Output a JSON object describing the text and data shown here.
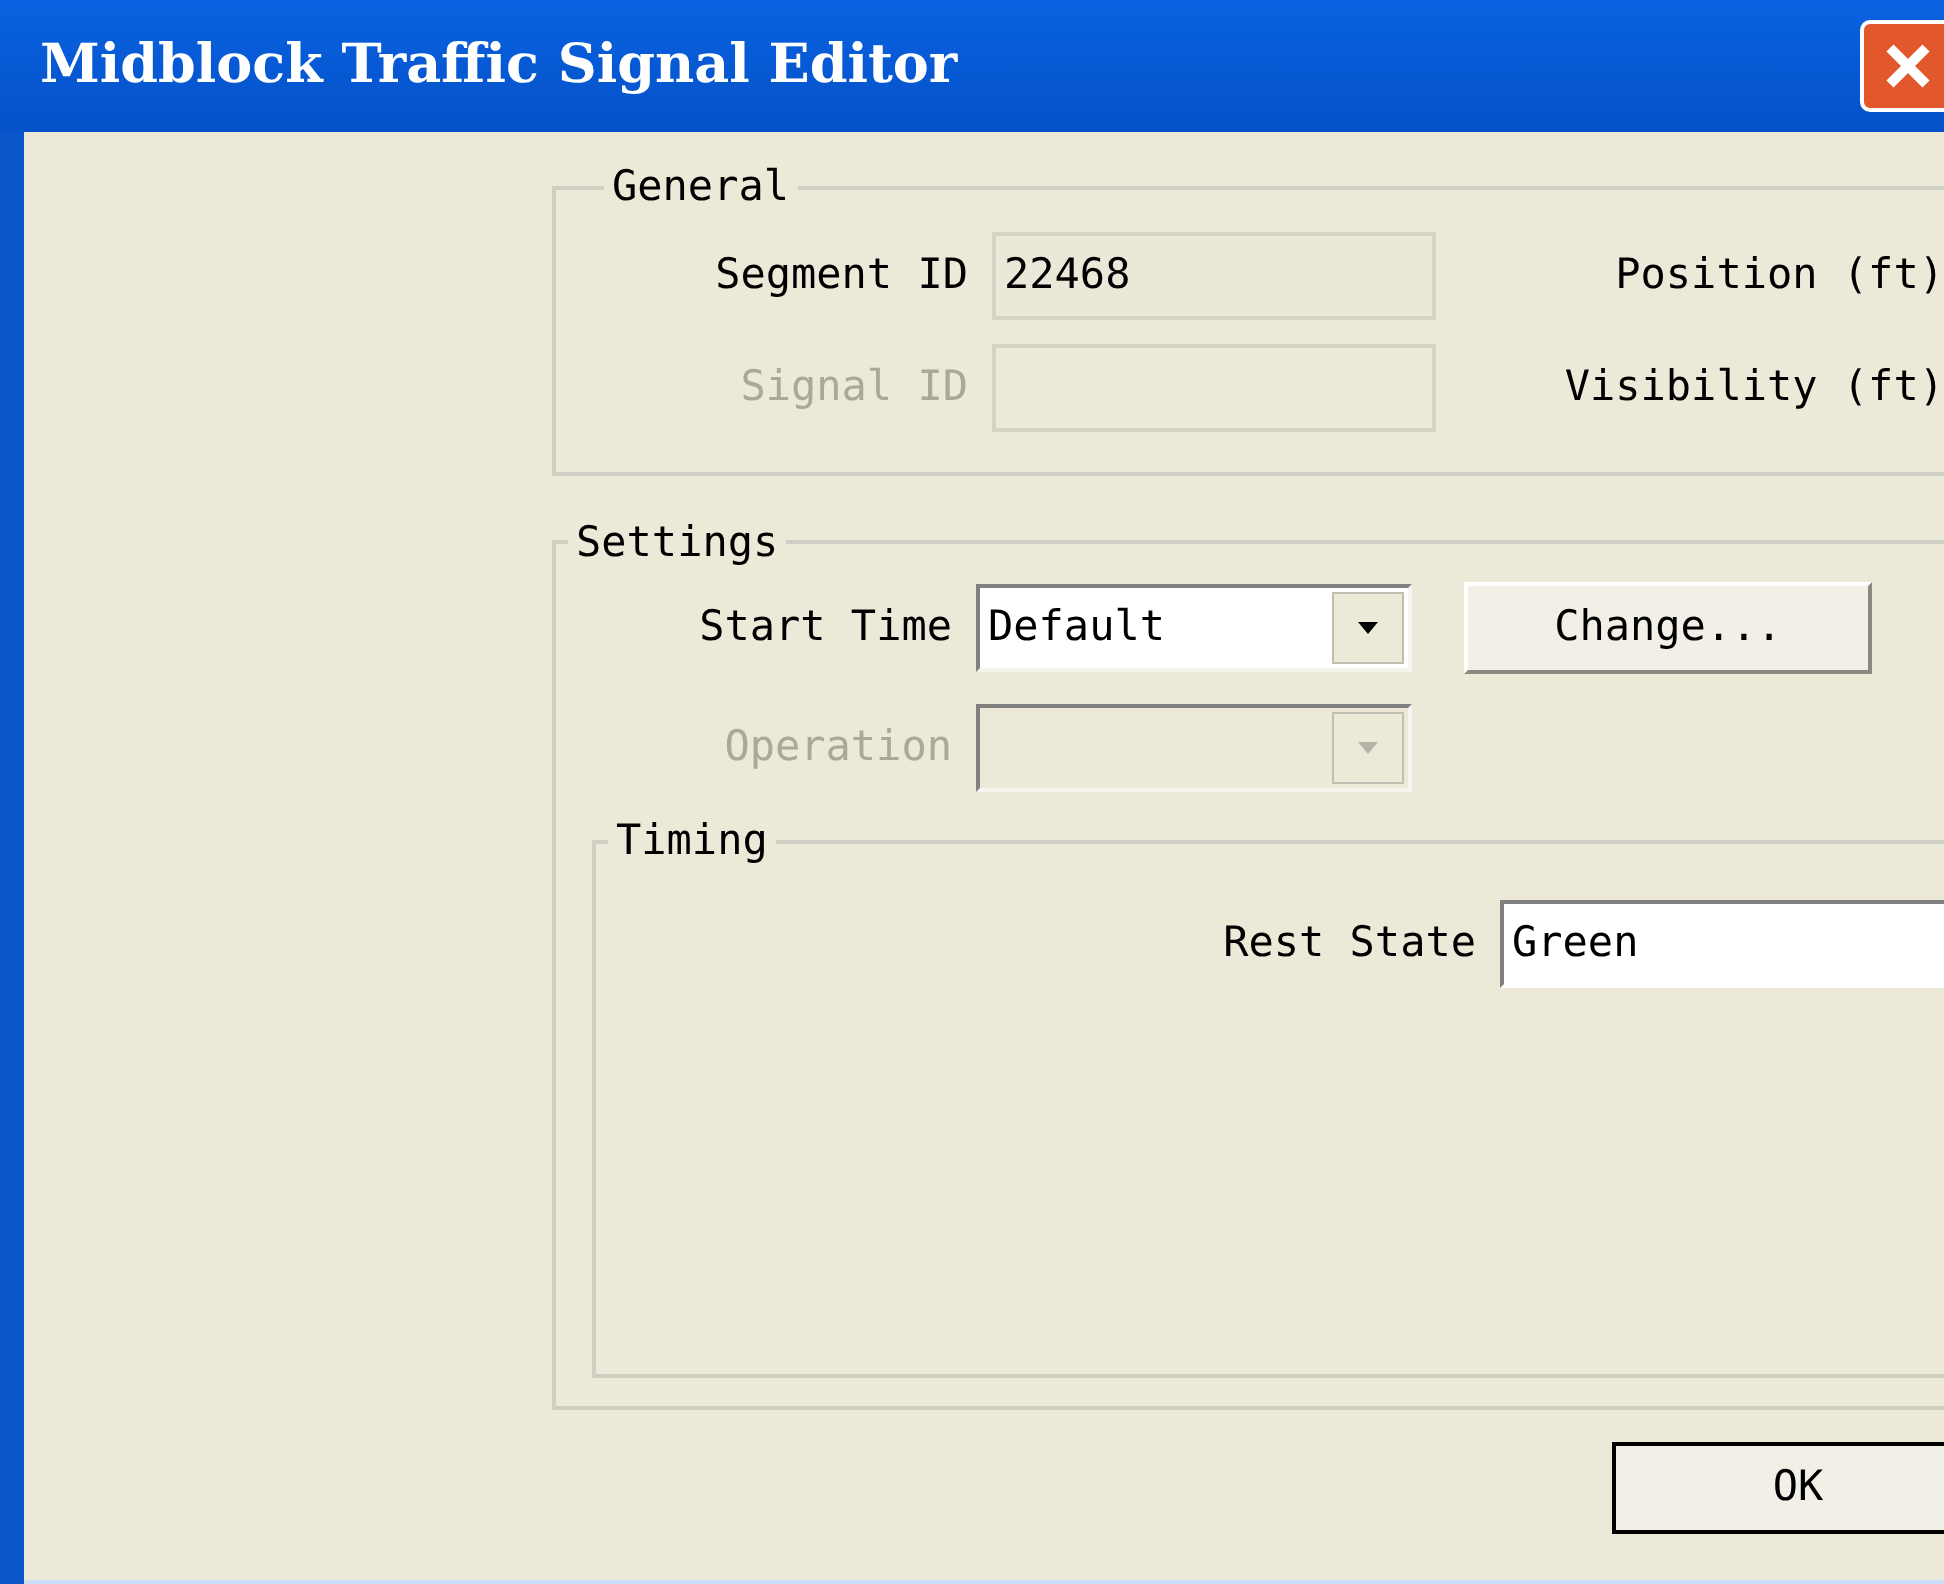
{
  "window": {
    "title": "Midblock Traffic Signal Editor"
  },
  "general": {
    "legend": "General",
    "rows": [
      {
        "label": "Segment ID",
        "value": "22468",
        "disabled": false,
        "side_label": "Position (ft)"
      },
      {
        "label": "Signal ID",
        "value": "",
        "disabled": true,
        "side_label": "Visibility (ft)"
      }
    ]
  },
  "settings": {
    "legend": "Settings",
    "dropdowns": [
      {
        "label": "Start Time",
        "value": "Default",
        "disabled": false,
        "button": "Change..."
      },
      {
        "label": "Operation",
        "disabled": true
      }
    ],
    "timing": {
      "legend": "Timing",
      "rest_state": {
        "label": "Rest State",
        "value": "Green"
      }
    }
  },
  "buttons": [
    "OK"
  ]
}
